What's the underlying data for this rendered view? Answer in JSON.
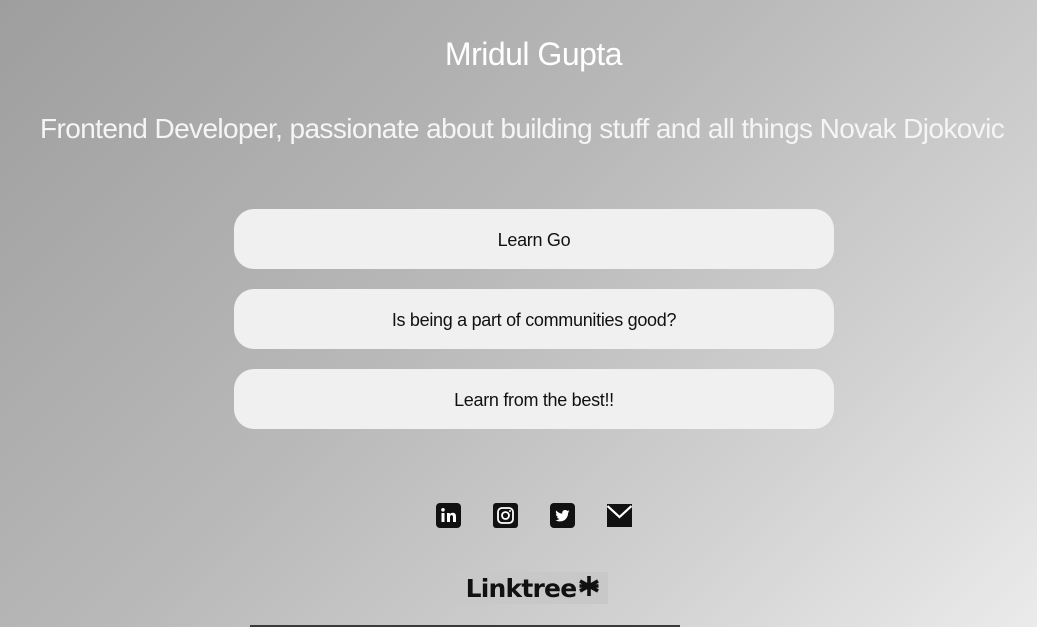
{
  "profile": {
    "name": "Mridul Gupta",
    "tagline": "Frontend Developer, passionate about building stuff and all things Novak Djokovic"
  },
  "links": [
    {
      "label": "Learn Go"
    },
    {
      "label": "Is being a part of communities good?"
    },
    {
      "label": "Learn from the best!!"
    }
  ],
  "socials": [
    {
      "icon": "linkedin-icon"
    },
    {
      "icon": "instagram-icon"
    },
    {
      "icon": "twitter-icon"
    },
    {
      "icon": "email-icon"
    }
  ],
  "brand": {
    "label": "Linktree",
    "icon": "linktree-asterisk-icon"
  },
  "colors": {
    "button_bg": "#f0f0f0",
    "text_light": "#ffffff",
    "text_dark": "#111111"
  }
}
